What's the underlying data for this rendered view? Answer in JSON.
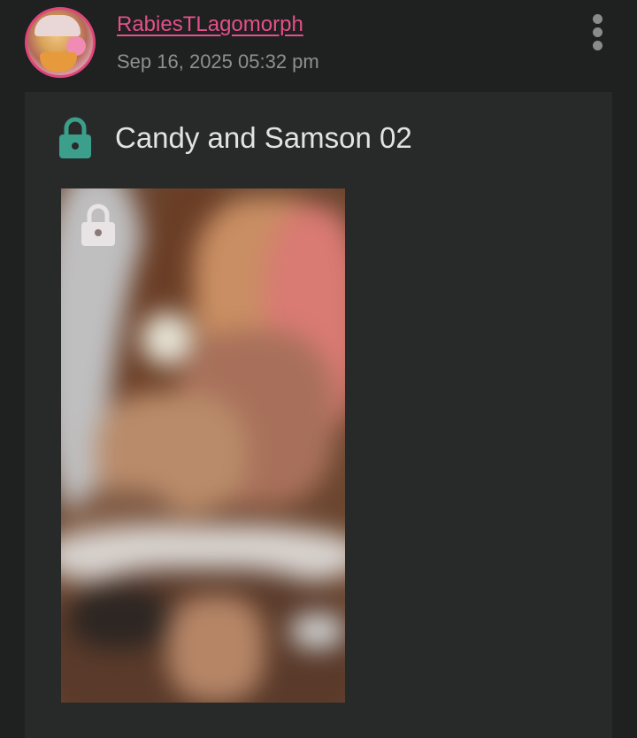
{
  "post": {
    "username": "RabiesTLagomorph",
    "timestamp": "Sep 16, 2025 05:32 pm",
    "title": "Candy and Samson 02"
  },
  "icons": {
    "title_lock": "lock-icon",
    "thumbnail_lock": "lock-icon",
    "menu": "more-vertical-icon"
  },
  "colors": {
    "username": "#e4508a",
    "lock_accent": "#3c9f8b",
    "card_background": "#282a2a",
    "page_background": "#1f2020"
  }
}
